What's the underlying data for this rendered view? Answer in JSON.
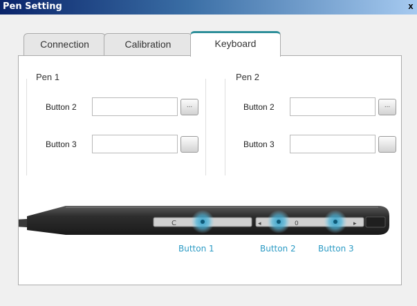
{
  "window": {
    "title": "Pen Setting",
    "close_glyph": "x"
  },
  "tabs": [
    {
      "label": "Connection"
    },
    {
      "label": "Calibration"
    },
    {
      "label": "Keyboard"
    }
  ],
  "active_tab": "Keyboard",
  "pen1": {
    "label": "Pen 1",
    "button2": {
      "label": "Button 2",
      "value": "",
      "browse": "..."
    },
    "button3": {
      "label": "Button 3",
      "value": "",
      "browse": ""
    }
  },
  "pen2": {
    "label": "Pen 2",
    "button2": {
      "label": "Button 2",
      "value": "",
      "browse": "..."
    },
    "button3": {
      "label": "Button 3",
      "value": "",
      "browse": ""
    }
  },
  "pen_graphic": {
    "labels": [
      "Button 1",
      "Button 2",
      "Button 3"
    ],
    "marks": {
      "a": "C",
      "b": "◂",
      "c": "0",
      "d": "▸"
    },
    "highlight_color": "#2a9ac4",
    "body_color": "#2e2e2e"
  }
}
